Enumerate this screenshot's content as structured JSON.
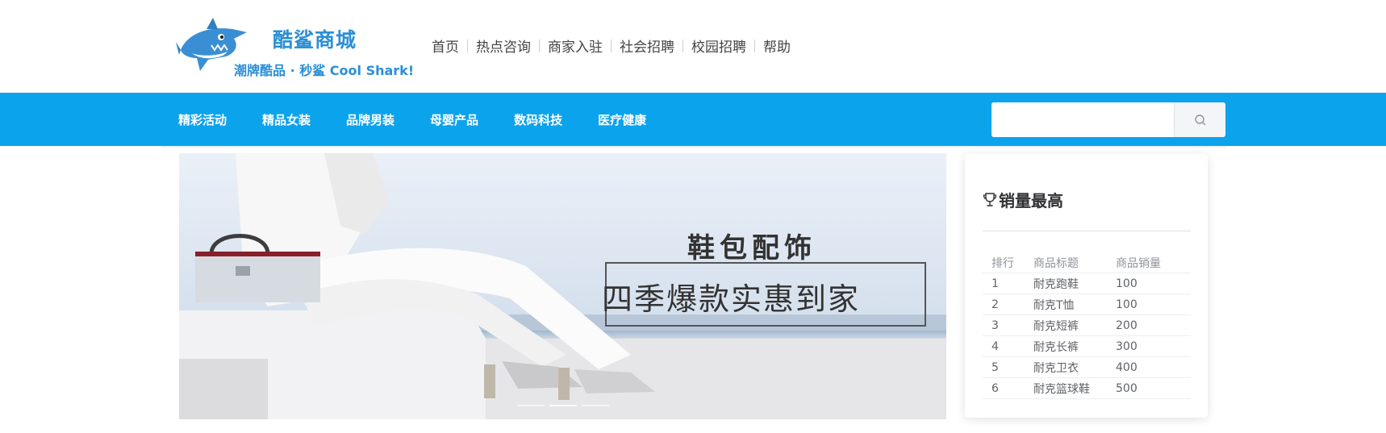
{
  "brand": {
    "title": "酷鲨商城",
    "slogan": "潮牌酷品 · 秒鲨 Cool Shark!",
    "accent_color": "#2a8fd6"
  },
  "top_nav": [
    "首页",
    "热点咨询",
    "商家入驻",
    "社会招聘",
    "校园招聘",
    "帮助"
  ],
  "menu": {
    "items": [
      "精彩活动",
      "精品女装",
      "品牌男装",
      "母婴产品",
      "数码科技",
      "医疗健康"
    ],
    "background_color": "#0ca3ed"
  },
  "search": {
    "value": "",
    "placeholder": "",
    "icon": "search-icon"
  },
  "banner": {
    "title": "鞋包配饰",
    "subtitle": "四季爆款实惠到家",
    "slide_count": 3,
    "active_slide": 2
  },
  "ranking": {
    "icon": "trophy-icon",
    "title": "销量最高",
    "columns": [
      "排行",
      "商品标题",
      "商品销量"
    ],
    "rows": [
      [
        "1",
        "耐克跑鞋",
        "100"
      ],
      [
        "2",
        "耐克T恤",
        "100"
      ],
      [
        "3",
        "耐克短裤",
        "200"
      ],
      [
        "4",
        "耐克长裤",
        "300"
      ],
      [
        "5",
        "耐克卫衣",
        "400"
      ],
      [
        "6",
        "耐克篮球鞋",
        "500"
      ]
    ]
  }
}
